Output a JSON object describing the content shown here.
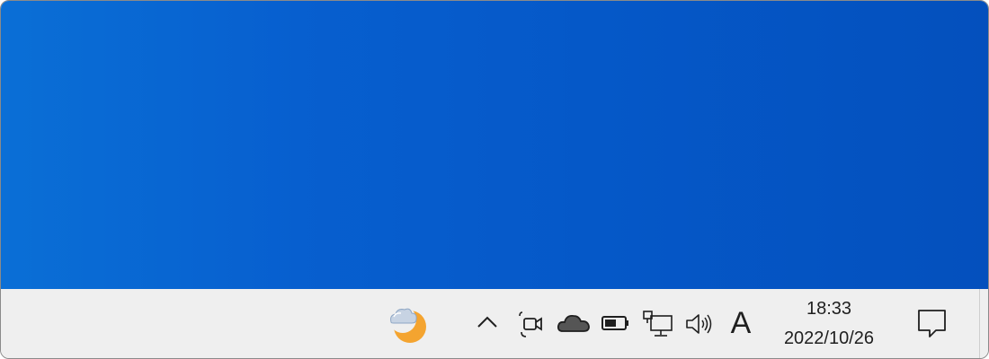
{
  "taskbar": {
    "ime_indicator": "A",
    "clock": {
      "time": "18:33",
      "date": "2022/10/26"
    },
    "icons": {
      "weather": "weather-partly-cloudy-night-icon",
      "chevron": "chevron-up-icon",
      "camera": "camera-in-use-icon",
      "onedrive": "onedrive-cloud-icon",
      "battery": "battery-icon",
      "network": "wired-network-icon",
      "volume": "speaker-volume-icon",
      "notifications": "notification-center-icon"
    }
  },
  "colors": {
    "desktop_left": "#0a6fd6",
    "desktop_right": "#0450bd",
    "taskbar_bg": "#efefef",
    "moon": "#f4a430"
  }
}
